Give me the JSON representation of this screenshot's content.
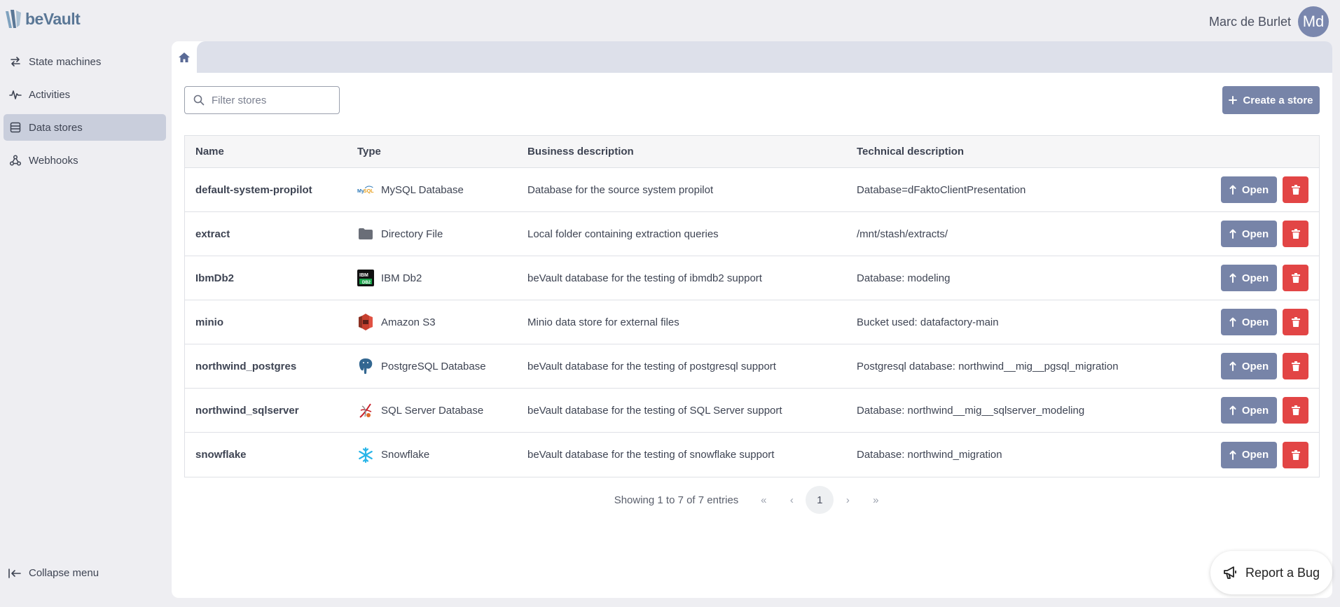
{
  "app": {
    "logo_text": "beVault"
  },
  "user": {
    "name": "Marc de Burlet",
    "initials": "Md"
  },
  "sidebar": {
    "items": [
      {
        "label": "State machines",
        "icon": "arrows-swap-icon"
      },
      {
        "label": "Activities",
        "icon": "pulse-icon"
      },
      {
        "label": "Data stores",
        "icon": "database-icon",
        "active": true
      },
      {
        "label": "Webhooks",
        "icon": "webhook-icon"
      }
    ],
    "collapse_label": "Collapse menu"
  },
  "toolbar": {
    "filter_placeholder": "Filter stores",
    "create_label": "Create a store"
  },
  "table": {
    "headers": [
      "Name",
      "Type",
      "Business description",
      "Technical description"
    ],
    "open_label": "Open",
    "rows": [
      {
        "name": "default-system-propilot",
        "type": "MySQL Database",
        "type_icon": "mysql-icon",
        "business": "Database for the source system propilot",
        "technical": "Database=dFaktoClientPresentation"
      },
      {
        "name": "extract",
        "type": "Directory File",
        "type_icon": "folder-icon",
        "business": "Local folder containing extraction queries",
        "technical": "/mnt/stash/extracts/"
      },
      {
        "name": "IbmDb2",
        "type": "IBM Db2",
        "type_icon": "ibm-db2-icon",
        "business": "beVault database for the testing of ibmdb2 support",
        "technical": "Database: modeling"
      },
      {
        "name": "minio",
        "type": "Amazon S3",
        "type_icon": "amazon-s3-icon",
        "business": "Minio data store for external files",
        "technical": "Bucket used: datafactory-main"
      },
      {
        "name": "northwind_postgres",
        "type": "PostgreSQL Database",
        "type_icon": "postgresql-icon",
        "business": "beVault database for the testing of postgresql support",
        "technical": "Postgresql database: northwind__mig__pgsql_migration"
      },
      {
        "name": "northwind_sqlserver",
        "type": "SQL Server Database",
        "type_icon": "sql-server-icon",
        "business": "beVault database for the testing of SQL Server support",
        "technical": "Database: northwind__mig__sqlserver_modeling"
      },
      {
        "name": "snowflake",
        "type": "Snowflake",
        "type_icon": "snowflake-icon",
        "business": "beVault database for the testing of snowflake support",
        "technical": "Database: northwind_migration"
      }
    ]
  },
  "pagination": {
    "summary": "Showing 1 to 7 of 7 entries",
    "current_page": "1",
    "first": "«",
    "prev": "‹",
    "next": "›",
    "last": "»"
  },
  "report_bug": {
    "label": "Report a Bug"
  },
  "colors": {
    "accent": "#7784a8",
    "danger": "#e24545",
    "active_nav": "#c9cedc"
  }
}
